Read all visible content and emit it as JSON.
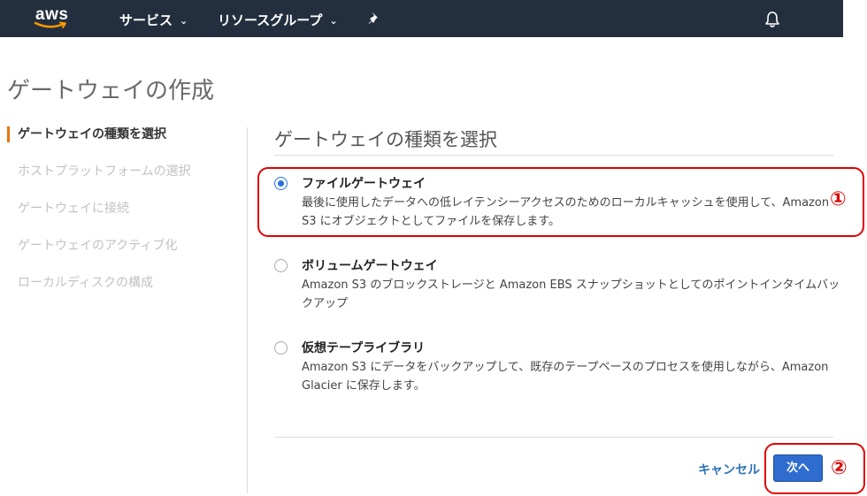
{
  "topbar": {
    "logo_text": "aws",
    "services_label": "サービス",
    "resource_groups_label": "リソースグループ"
  },
  "page": {
    "title": "ゲートウェイの作成"
  },
  "steps": [
    {
      "label": "ゲートウェイの種類を選択",
      "active": true
    },
    {
      "label": "ホストプラットフォームの選択",
      "active": false
    },
    {
      "label": "ゲートウェイに接続",
      "active": false
    },
    {
      "label": "ゲートウェイのアクティブ化",
      "active": false
    },
    {
      "label": "ローカルディスクの構成",
      "active": false
    }
  ],
  "panel": {
    "title": "ゲートウェイの種類を選択",
    "options": [
      {
        "title": "ファイルゲートウェイ",
        "description": "最後に使用したデータへの低レイテンシーアクセスのためのローカルキャッシュを使用して、Amazon S3 にオブジェクトとしてファイルを保存します。",
        "selected": true
      },
      {
        "title": "ボリュームゲートウェイ",
        "description": "Amazon S3 のブロックストレージと Amazon EBS スナップショットとしてのポイントインタイムバックアップ",
        "selected": false
      },
      {
        "title": "仮想テープライブラリ",
        "description": "Amazon S3 にデータをバックアップして、既存のテープベースのプロセスを使用しながら、Amazon Glacier に保存します。",
        "selected": false
      }
    ]
  },
  "actions": {
    "cancel_label": "キャンセル",
    "next_label": "次へ"
  },
  "annotations": {
    "marker_1": "①",
    "marker_2": "②"
  },
  "colors": {
    "topbar_bg": "#232f3e",
    "accent_orange": "#ec7211",
    "primary_blue": "#2e6ccf",
    "annotation_red": "#e00000"
  },
  "icons": {
    "nav_chevron": "chevron-down-icon",
    "pin": "pin-icon",
    "notifications": "bell-icon"
  }
}
